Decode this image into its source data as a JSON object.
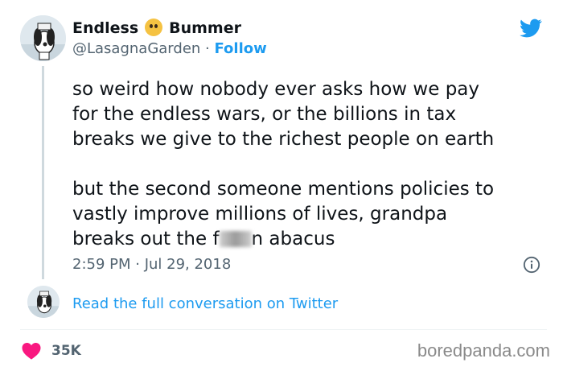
{
  "author": {
    "name_part1": "Endless",
    "name_emoji": "face-screaming-in-fear-emoji",
    "name_part2": "Bummer",
    "handle": "@LasagnaGarden",
    "separator": " · ",
    "follow_label": "Follow"
  },
  "tweet": {
    "paragraph1": "so weird how nobody ever asks how we pay\nfor the endless wars, or the billions in tax\nbreaks we give to the richest people on earth",
    "paragraph2_line1": "but the second someone mentions policies to",
    "paragraph2_line2": "vastly improve millions of lives, grandpa",
    "paragraph2_line3_before": "breaks out the f",
    "paragraph2_line3_after": "n abacus",
    "timestamp": "2:59 PM · Jul 29, 2018"
  },
  "conversation_link": "Read the full conversation on Twitter",
  "likes": {
    "count": "35K",
    "icon": "heart-icon",
    "color": "#f91880"
  },
  "watermark": "boredpanda.com",
  "colors": {
    "twitter_blue": "#1d9bf0",
    "secondary_text": "#536471"
  }
}
